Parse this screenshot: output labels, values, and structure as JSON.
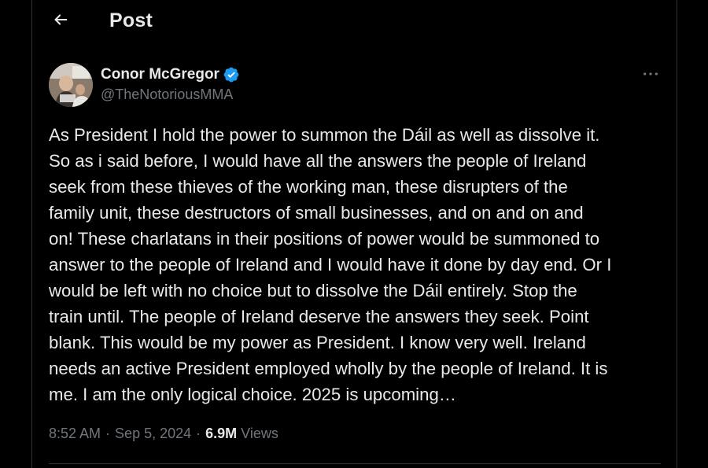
{
  "header": {
    "title": "Post",
    "back_icon": "arrow-left-icon"
  },
  "author": {
    "display_name": "Conor McGregor",
    "handle": "@TheNotoriousMMA",
    "verified": true,
    "verified_color": "#1d9bf0"
  },
  "tweet": {
    "text": "As President I hold the power to summon the Dáil as well as dissolve it.\nSo as i said before, I would have all the answers the people of Ireland\nseek from these thieves of the working man, these disrupters of the\nfamily unit, these destructors of small businesses, and on and on and\non! These charlatans in their positions of power would be summoned to\nanswer to the people of Ireland and I would have it done by day end. Or I\nwould be left with no choice but to dissolve the Dáil entirely. Stop the\ntrain until. The people of Ireland deserve the answers they seek. Point\nblank. This would be my power as President. I know very well. Ireland\nneeds an active President employed wholly by the people of Ireland. It is\nme. I am the only logical choice. 2025 is upcoming…"
  },
  "meta": {
    "time": "8:52 AM",
    "separator": "·",
    "date": "Sep 5, 2024",
    "views_count": "6.9M",
    "views_label": "Views"
  },
  "colors": {
    "background": "#000000",
    "text_primary": "#e7e9ea",
    "text_secondary": "#71767b",
    "border": "#2f3336"
  }
}
